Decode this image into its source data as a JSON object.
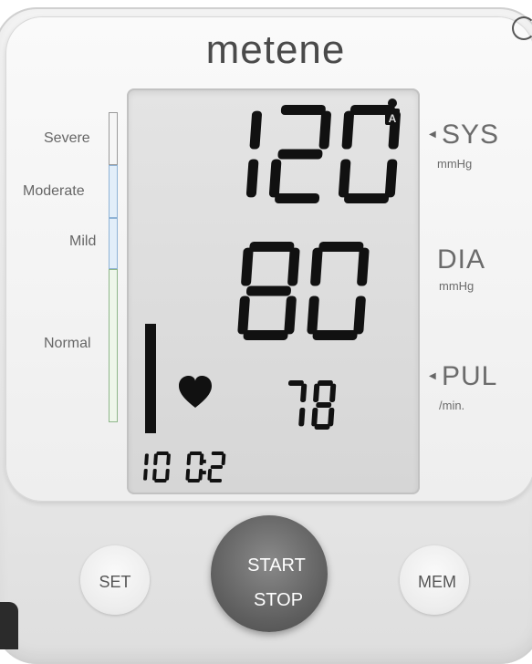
{
  "brand": "metene",
  "scale": {
    "severe": "Severe",
    "moderate": "Moderate",
    "mild": "Mild",
    "normal": "Normal"
  },
  "display": {
    "systolic": "120",
    "diastolic": "80",
    "pulse": "78",
    "time": "10:02",
    "user": "A",
    "heart_icon": "heart-icon",
    "user_icon": "user-icon"
  },
  "units": {
    "sys": "SYS",
    "sys_unit": "mmHg",
    "dia": "DIA",
    "dia_unit": "mmHg",
    "pul": "PUL",
    "pul_unit": "/min."
  },
  "buttons": {
    "set": "SET",
    "start": "START",
    "stop": "STOP",
    "mem": "MEM"
  },
  "colors": {
    "lcd_digit": "#111111",
    "lcd_background": "#dcdcdc",
    "start_button": "#5f5f5f"
  }
}
